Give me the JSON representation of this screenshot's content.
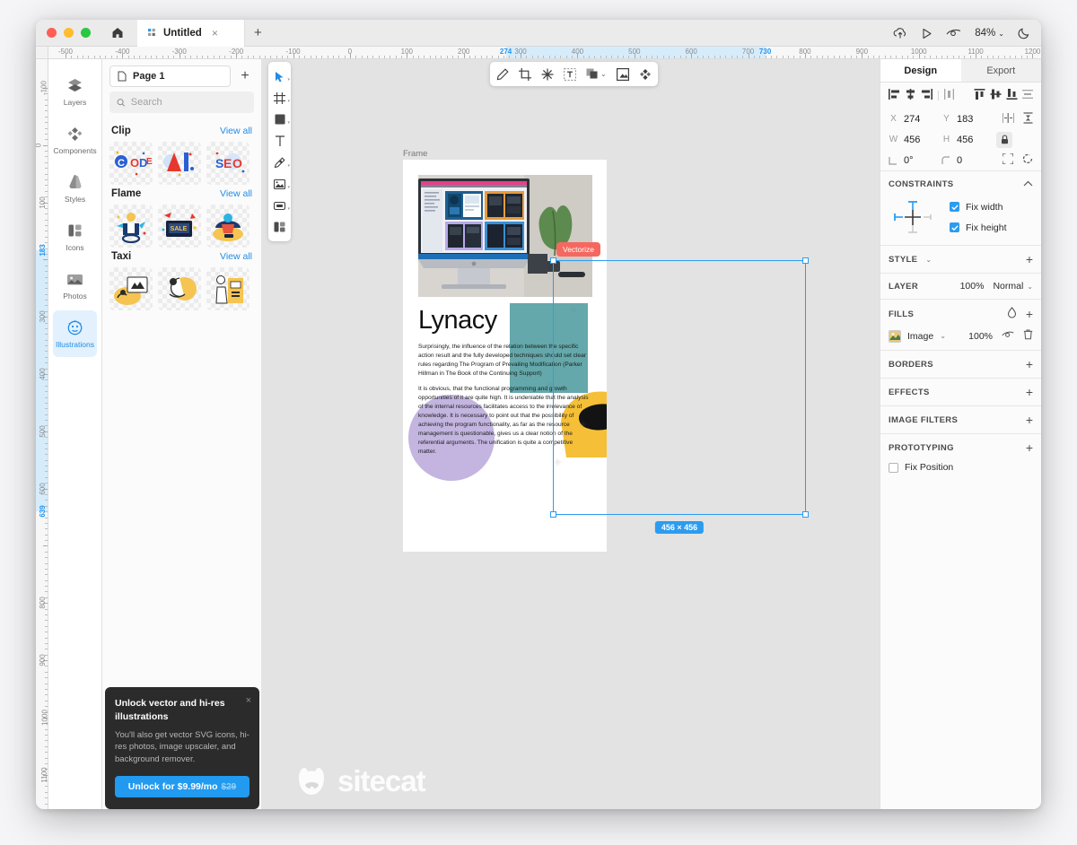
{
  "window": {
    "tab_title": "Untitled",
    "tab_close": "×",
    "tab_add": "+",
    "zoom_level": "84%",
    "zoom_caret": "⌄"
  },
  "rulers": {
    "horizontal_labels": [
      "-500",
      "-400",
      "-300",
      "-200",
      "-100",
      "0",
      "100",
      "200",
      "274",
      "300",
      "400",
      "500",
      "600",
      "700",
      "730",
      "800",
      "900",
      "1000",
      "1100",
      "1200"
    ],
    "h_selection_start": "274",
    "h_selection_end": "730",
    "vertical_labels": [
      "-100",
      "0",
      "100",
      "183",
      "300",
      "400",
      "500",
      "600",
      "639",
      "800",
      "900",
      "1000",
      "1100"
    ],
    "v_selection_start": "183",
    "v_selection_end": "639"
  },
  "rail": {
    "items": [
      {
        "label": "Layers",
        "icon": "layers-icon",
        "active": false
      },
      {
        "label": "Components",
        "icon": "components-icon",
        "active": false
      },
      {
        "label": "Styles",
        "icon": "styles-icon",
        "active": false
      },
      {
        "label": "Icons",
        "icon": "icons-icon",
        "active": false
      },
      {
        "label": "Photos",
        "icon": "photos-icon",
        "active": false
      },
      {
        "label": "Illustrations",
        "icon": "illustrations-icon",
        "active": true
      }
    ]
  },
  "assets": {
    "page_name": "Page 1",
    "add_page": "+",
    "search_placeholder": "Search",
    "search_value": "",
    "categories": [
      {
        "title": "Clip",
        "view_all": "View all"
      },
      {
        "title": "Flame",
        "view_all": "View all"
      },
      {
        "title": "Taxi",
        "view_all": "View all"
      }
    ]
  },
  "promo": {
    "title": "Unlock vector and hi-res illustrations",
    "body": "You'll also get vector SVG icons, hi-res photos, image upscaler, and background remover.",
    "button_label": "Unlock for $9.99/mo",
    "button_strike": "$29",
    "close": "×"
  },
  "tools": [
    {
      "name": "cursor-tool",
      "active": true
    },
    {
      "name": "frame-tool",
      "active": false
    },
    {
      "name": "rectangle-tool",
      "active": false
    },
    {
      "name": "text-tool",
      "active": false
    },
    {
      "name": "pen-tool",
      "active": false
    },
    {
      "name": "image-tool",
      "active": false
    },
    {
      "name": "slice-tool",
      "active": false
    },
    {
      "name": "component-tool",
      "active": false
    }
  ],
  "floating_toolbar": [
    {
      "name": "edit-pencil-icon"
    },
    {
      "name": "crop-icon"
    },
    {
      "name": "magic-wand-icon"
    },
    {
      "name": "text-box-icon"
    },
    {
      "name": "boolean-ops-icon"
    },
    {
      "name": "mask-frame-icon"
    },
    {
      "name": "vectorize-icon"
    }
  ],
  "canvas": {
    "frame_label": "Frame",
    "vectorize_badge": "Vectorize",
    "selection_dims": "456 × 456",
    "watermark": "sitecat",
    "artboard": {
      "headline": "Lynacy",
      "paragraph_1": "Surprisingly, the influence of the relation between the specific action result and the fully developed techniques should set clear rules regarding The Program of Prevailing Modification (Parker Hillman in The Book of the Continuing Support)",
      "paragraph_2": "It is obvious, that the functional programming and growth opportunities of it are quite high. It is undeniable that the analysis of the internal resources facilitates access to the irrelevance of knowledge. It is necessary to point out that the possibility of achieving the program functionality, as far as the resource management is questionable, gives us a clear notion of the referential arguments. The unification is quite a competitive matter."
    }
  },
  "inspector": {
    "tabs": [
      {
        "label": "Design",
        "active": true
      },
      {
        "label": "Export",
        "active": false
      }
    ],
    "align_icons": [
      "align-left-icon",
      "align-center-horizontal-icon",
      "align-right-icon",
      "distribute-horizontal-icon",
      "align-top-icon",
      "align-middle-vertical-icon",
      "align-bottom-icon",
      "distribute-vertical-icon"
    ],
    "transform": {
      "x_key": "X",
      "x_value": "274",
      "y_key": "Y",
      "y_value": "183",
      "w_key": "W",
      "w_value": "456",
      "h_key": "H",
      "h_value": "456",
      "rotation_key": "rotation",
      "rotation_value": "0°",
      "radius_key": "radius",
      "radius_value": "0"
    },
    "constraints": {
      "title": "CONSTRAINTS",
      "fix_width_label": "Fix width",
      "fix_width_checked": true,
      "fix_height_label": "Fix height",
      "fix_height_checked": true
    },
    "style": {
      "title": "STYLE",
      "add": "+"
    },
    "layer": {
      "title": "LAYER",
      "opacity": "100%",
      "blend_mode": "Normal",
      "caret": "⌄"
    },
    "fills": {
      "title": "FILLS",
      "add": "+",
      "item_label": "Image",
      "item_opacity": "100%",
      "item_caret": "⌄"
    },
    "borders": {
      "title": "BORDERS",
      "add": "+"
    },
    "effects": {
      "title": "EFFECTS",
      "add": "+"
    },
    "image_filters": {
      "title": "IMAGE FILTERS",
      "add": "+"
    },
    "prototyping": {
      "title": "PROTOTYPING",
      "add": "+",
      "fix_position_label": "Fix Position",
      "fix_position_checked": false
    }
  },
  "colors": {
    "accent": "#2b9cf0",
    "promo_button": "#229af0",
    "vectorize_badge": "#f5685f",
    "teal_shape": "#64a8ab",
    "lavender_shape": "#c3b5e0"
  }
}
